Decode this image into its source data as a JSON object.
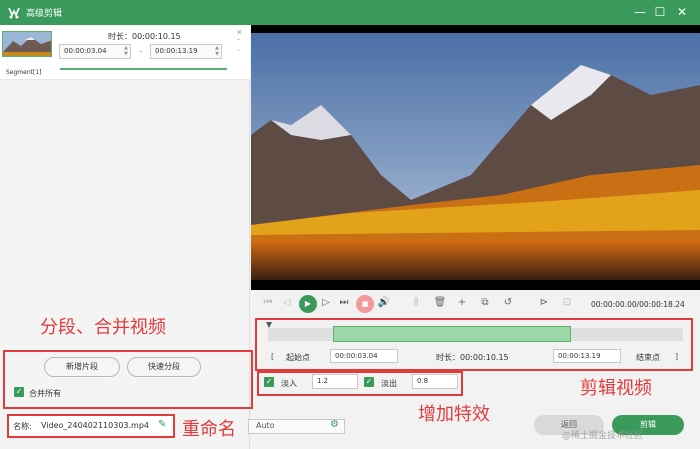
{
  "window": {
    "title": "高级剪辑"
  },
  "segment": {
    "duration": "时长：00:00:10.15",
    "start": "00:00:03.04",
    "end": "00:00:13.19",
    "label": "Segment[1]"
  },
  "annotations": {
    "split_merge": "分段、合并视频",
    "rename": "重命名",
    "trim": "剪辑视频",
    "effects": "增加特效"
  },
  "buttons": {
    "add_segment": "新增片段",
    "quick_split": "快速分段",
    "merge_all": "合并所有",
    "back": "返回",
    "trim": "剪辑"
  },
  "name": {
    "label": "名称:",
    "value": "Video_240402110303.mp4"
  },
  "output_auto": "Auto",
  "playback": {
    "time": "00:00:00.00/00:00:18.24"
  },
  "trim": {
    "start_label": "起始点",
    "start_value": "00:00:03.04",
    "duration": "时长：00:00:10.15",
    "end_value": "00:00:13.19",
    "end_label": "结束点",
    "bracket_open": "[",
    "bracket_close": "]"
  },
  "effects": {
    "fade_in_label": "淡入",
    "fade_in_value": "1.2",
    "fade_out_label": "淡出",
    "fade_out_value": "0.8"
  },
  "watermark": "@稀土掘金技术社区",
  "colors": {
    "accent": "#3a9a5b",
    "annotation_red": "#e23b3b"
  }
}
